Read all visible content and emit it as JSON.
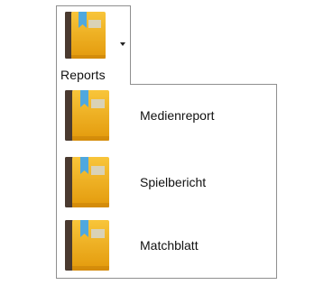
{
  "ribbon": {
    "reports_button": {
      "label": "Reports",
      "icon": "book-icon",
      "has_dropdown": true
    }
  },
  "menu": {
    "items": [
      {
        "label": "Medienreport",
        "icon": "book-icon"
      },
      {
        "label": "Spielbericht",
        "icon": "book-icon"
      },
      {
        "label": "Matchblatt",
        "icon": "book-icon"
      }
    ]
  },
  "colors": {
    "book_cover_light": "#f8c53a",
    "book_cover_dark": "#e39a0c",
    "book_spine": "#4a3a30",
    "bookmark": "#4fa8de",
    "label_box": "#d9d2b7",
    "border": "#8f8f8f",
    "text": "#111111"
  }
}
